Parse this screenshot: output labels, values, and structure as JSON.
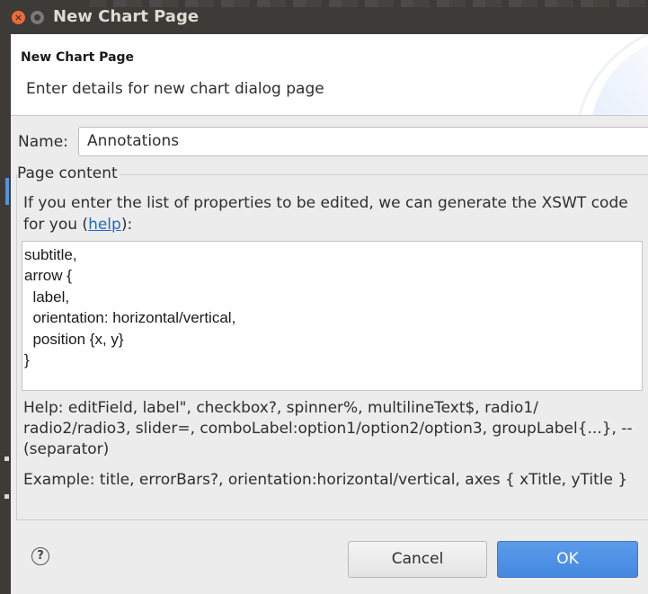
{
  "window": {
    "title": "New Chart Page"
  },
  "header": {
    "title": "New Chart Page",
    "description": "Enter details for new chart dialog page"
  },
  "form": {
    "name_label": "Name:",
    "name_value": "Annotations"
  },
  "page_content": {
    "legend": "Page content",
    "intro_text": "If you enter the list of properties to be edited, we can generate the XSWT code for you (",
    "help_link": "help",
    "intro_suffix": "):",
    "properties_text": "subtitle,\narrow {\n  label,\n  orientation: horizontal/vertical,\n  position {x, y}\n}",
    "help_text": "Help: editField, label\", checkbox?, spinner%, multilineText$, radio1/ radio2/radio3, slider=, comboLabel:option1/option2/option3, groupLabel{...}, -- (separator)",
    "example_text": "Example: title, errorBars?, orientation:horizontal/vertical, axes { xTitle, yTitle }"
  },
  "buttons": {
    "help_icon": "?",
    "cancel": "Cancel",
    "ok": "OK"
  },
  "icons": [
    "close-icon",
    "minimize-icon",
    "help-icon"
  ],
  "colors": {
    "accent": "#4a8fe4",
    "titlebar": "#3c3b37",
    "close": "#ef6b38",
    "link": "#1b6ac9"
  }
}
